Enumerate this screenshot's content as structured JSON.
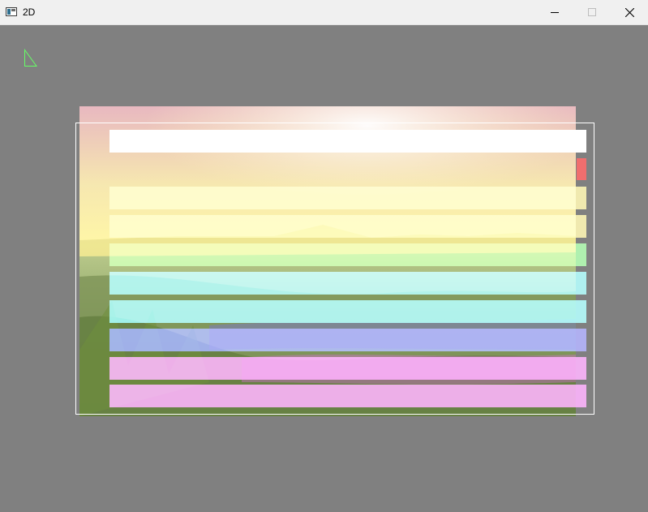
{
  "window": {
    "title": "2D",
    "icon": "app-window-icon",
    "buttons": [
      "minimize-icon",
      "maximize-icon",
      "close-icon"
    ]
  },
  "canvas": {
    "background": "#808080",
    "corner_shape_color": "#66ff66",
    "frame_color": "#ffffff",
    "bars": [
      {
        "name": "white",
        "color": "#ffffff"
      },
      {
        "name": "red",
        "color": "#ff6b6b"
      },
      {
        "name": "yellow",
        "color": "#fff06b"
      },
      {
        "name": "yellow",
        "color": "#fff06b"
      },
      {
        "name": "green",
        "color": "#6bff6b"
      },
      {
        "name": "cyan",
        "color": "#6bffff"
      },
      {
        "name": "cyan",
        "color": "#6bffff"
      },
      {
        "name": "blue",
        "color": "#6b6bff"
      },
      {
        "name": "magenta",
        "color": "#ff6bff"
      },
      {
        "name": "magenta",
        "color": "#ff6bff"
      }
    ]
  }
}
